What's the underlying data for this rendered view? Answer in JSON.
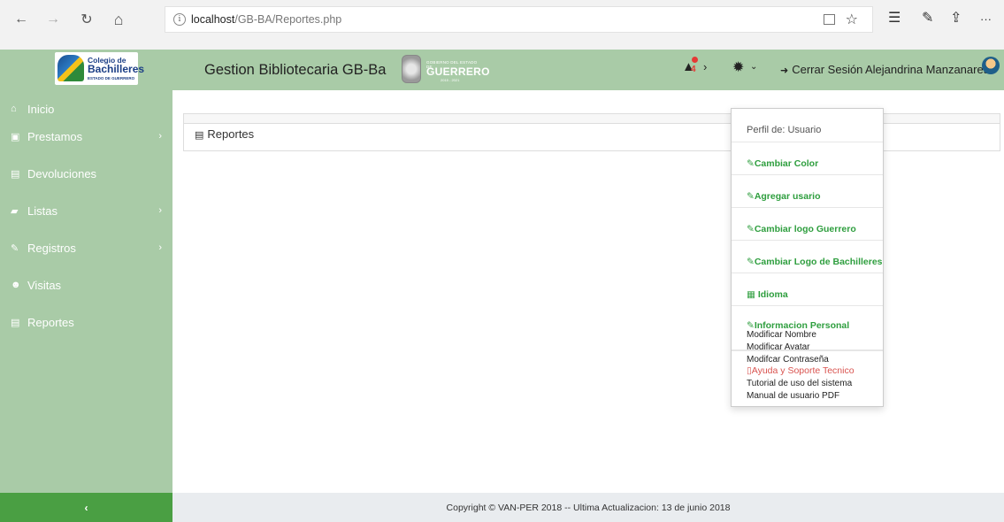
{
  "browser": {
    "back": "←",
    "forward": "→",
    "refresh": "↻",
    "home": "⌂",
    "url_host": "localhost",
    "url_path": "/GB-BA/Reportes.php",
    "favorite_icon": "☆",
    "favorites_list_icon": "☰",
    "pen_icon": "✎",
    "share_icon": "⇪",
    "more_icon": "···"
  },
  "header": {
    "logo_bach_line1": "Colegio de",
    "logo_bach_line2": "Bachilleres",
    "logo_bach_line3": "ESTADO DE GUERRERO",
    "app_title": "Gestion Bibliotecaria GB-Ba",
    "logo_gro_small": "GOBIERNO DEL ESTADO DE",
    "logo_gro_big": "GUERRERO",
    "logo_gro_years": "2015 - 2021",
    "notification_count": "4",
    "logout_label": "Cerrar Sesión",
    "user_name": "Alejandrina Manzanares"
  },
  "sidebar": {
    "items": [
      {
        "icon": "⌂",
        "label": "Inicio",
        "arrow": ""
      },
      {
        "icon": "▣",
        "label": "Prestamos",
        "arrow": "›"
      },
      {
        "icon": "▤",
        "label": "Devoluciones",
        "arrow": ""
      },
      {
        "icon": "▰",
        "label": "Listas",
        "arrow": "›"
      },
      {
        "icon": "✎",
        "label": "Registros",
        "arrow": "›"
      },
      {
        "icon": "☻",
        "label": "Visitas",
        "arrow": ""
      },
      {
        "icon": "▤",
        "label": "Reportes",
        "arrow": ""
      }
    ],
    "collapse": "‹"
  },
  "main": {
    "panel_title": "Reportes"
  },
  "dropdown": {
    "profile": "Perfil de: Usuario",
    "change_color": "Cambiar Color",
    "add_user": "Agregar usario",
    "change_logo_gro": "Cambiar logo Guerrero",
    "change_logo_bach": "Cambiar Logo de Bachilleres",
    "language": "Idioma",
    "personal_info": "Informacion Personal",
    "modify_name": "Modificar Nombre",
    "modify_avatar": "Modificar Avatar",
    "modify_password": "Modifcar Contraseña",
    "help": "Ayuda y Soporte Tecnico",
    "tutorial": "Tutorial de uso del sistema",
    "manual": "Manual de usuario PDF"
  },
  "footer": {
    "text": "Copyright © VAN-PER 2018 -- Ultima Actualizacion: 13 de junio 2018"
  }
}
